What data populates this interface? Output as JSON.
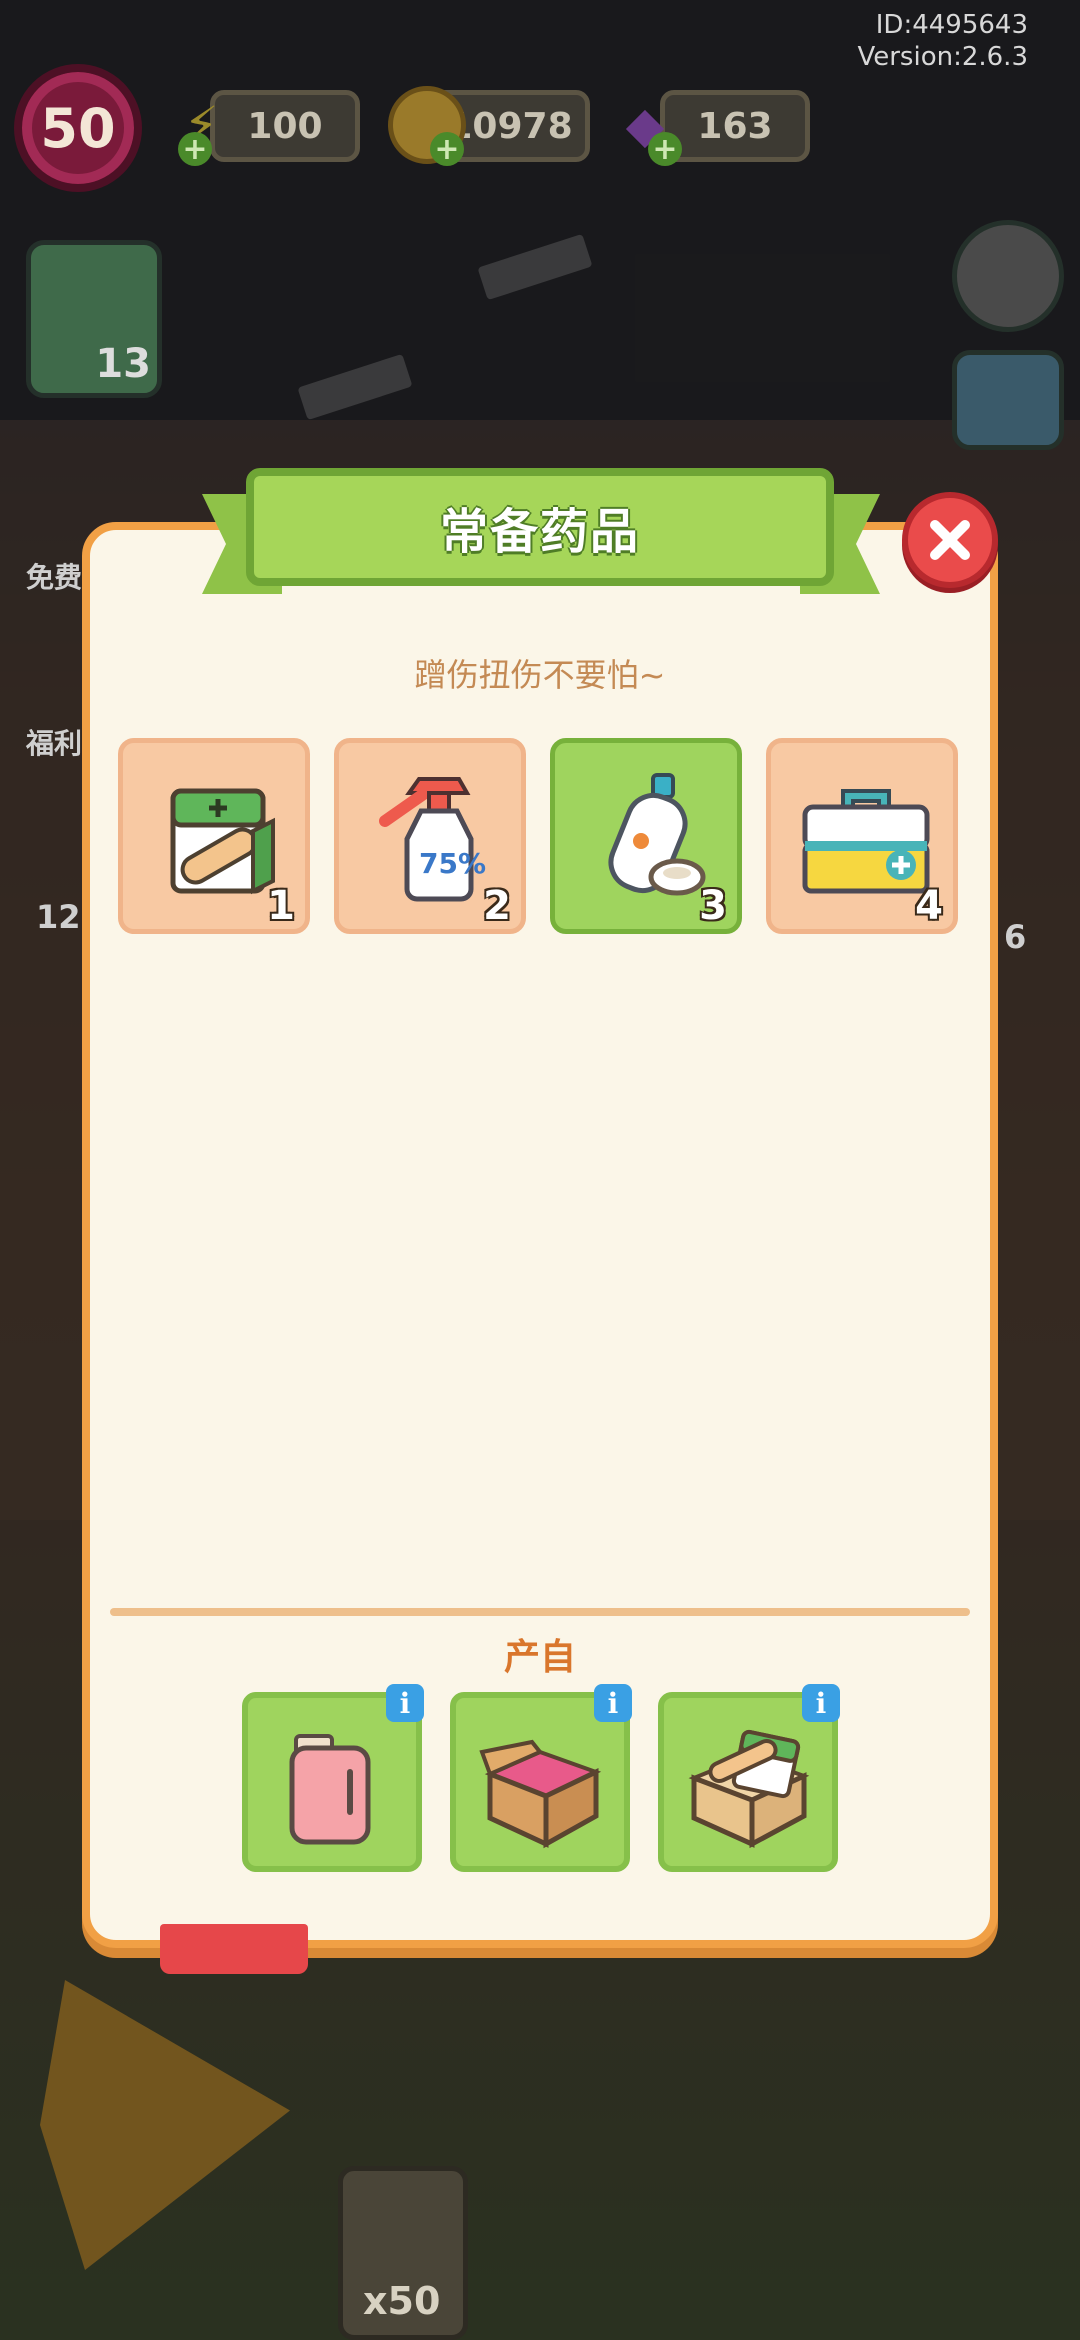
{
  "hud": {
    "level": "50",
    "energy": "100",
    "coins": "10978",
    "gems": "163",
    "plus": "+",
    "player_id": "ID:4495643",
    "version": "Version:2.6.3",
    "clipboard_count": "13",
    "side_label_free": "免费",
    "side_label_welfare": "福利",
    "side_count_left": "12",
    "side_count_right": "6",
    "bottom_multiplier": "x50"
  },
  "dialog": {
    "title": "常备药品",
    "subtitle": "蹭伤扭伤不要怕~",
    "items": [
      {
        "name": "bandage-box",
        "level": "1",
        "selected": false
      },
      {
        "name": "alcohol-spray",
        "level": "2",
        "selected": false
      },
      {
        "name": "disinfectant-bottle",
        "level": "3",
        "selected": true
      },
      {
        "name": "first-aid-kit",
        "level": "4",
        "selected": false
      }
    ],
    "source_label": "产自",
    "info_glyph": "i",
    "sources": [
      {
        "name": "mini-fridge"
      },
      {
        "name": "cardboard-box-pink"
      },
      {
        "name": "cardboard-box-bandages"
      }
    ]
  },
  "colors": {
    "panel_bg": "#fbf6e8",
    "panel_border": "#f1a045",
    "banner_green": "#a6d659",
    "slot_peach": "#f8c9a3",
    "slot_green": "#9fd45e",
    "close_red": "#ea4b4b",
    "info_blue": "#3aa0e4"
  }
}
